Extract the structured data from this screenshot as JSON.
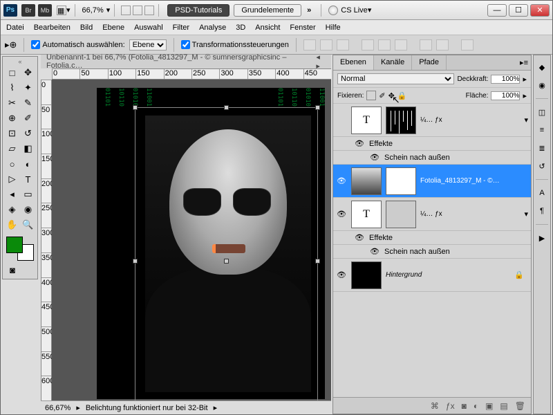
{
  "titlebar": {
    "ps": "Ps",
    "br": "Br",
    "mb": "Mb",
    "zoom": "66,7%",
    "ws1": "PSD-Tutorials",
    "ws2": "Grundelemente",
    "cslive": "CS Live"
  },
  "menu": [
    "Datei",
    "Bearbeiten",
    "Bild",
    "Ebene",
    "Auswahl",
    "Filter",
    "Analyse",
    "3D",
    "Ansicht",
    "Fenster",
    "Hilfe"
  ],
  "opt": {
    "auto": "Automatisch auswählen:",
    "auto_sel": "Ebene",
    "trans": "Transformationssteuerungen"
  },
  "doc": {
    "title": "Unbenannt-1 bei 66,7% (Fotolia_4813297_M - © sumnersgraphicsinc – Fotolia.c…"
  },
  "ruler_h": [
    "0",
    "50",
    "100",
    "150",
    "200",
    "250",
    "300",
    "350",
    "400",
    "450"
  ],
  "ruler_v": [
    "0",
    "50",
    "100",
    "150",
    "200",
    "250",
    "300",
    "350",
    "400",
    "450",
    "500",
    "550",
    "600"
  ],
  "status": {
    "zoom": "66,67%",
    "msg": "Belichtung funktioniert nur bei 32-Bit"
  },
  "panel": {
    "tabs": [
      "Ebenen",
      "Kanäle",
      "Pfade"
    ],
    "blend": "Normal",
    "blend_opts": [
      "Normal"
    ],
    "opacity_lbl": "Deckkraft:",
    "opacity": "100%",
    "lock_lbl": "Fixieren:",
    "fill_lbl": "Fläche:",
    "fill": "100%",
    "fx_lbl": "¼… ƒx",
    "effects": "Effekte",
    "outerglow": "Schein nach außen",
    "layer_sel": "Fotolia_4813297_M - ©…",
    "layer_bg": "Hintergrund",
    "t": "T"
  }
}
